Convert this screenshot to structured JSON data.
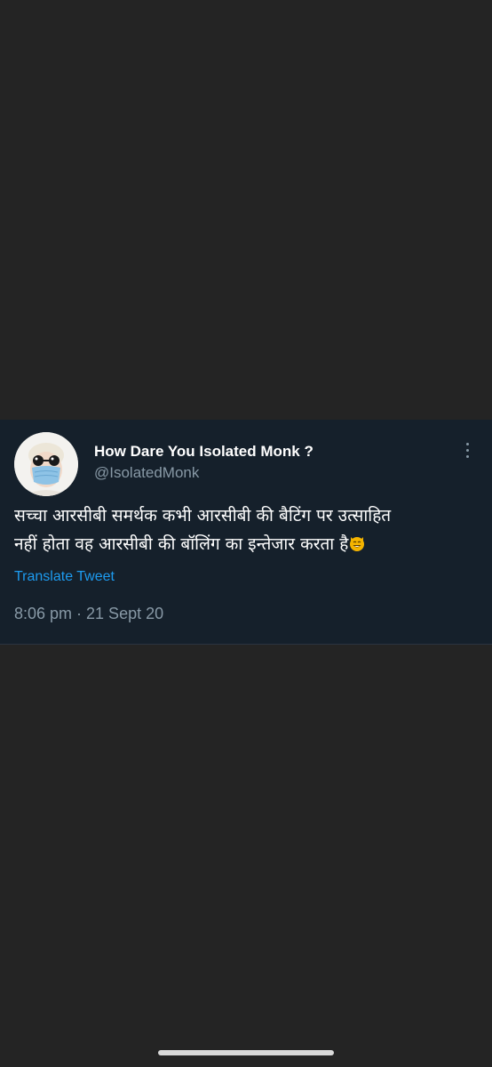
{
  "tweet": {
    "display_name": "How Dare You Isolated Monk ?",
    "handle": "@IsolatedMonk",
    "text_line1": "सच्चा आरसीबी समर्थक कभी आरसीबी की बैटिंग पर उत्साहित",
    "text_line2": "नहीं होता वह आरसीबी की बॉलिंग का इन्तेजार करता है",
    "emoji_icon": "grinning-cat-emoji",
    "translate_label": "Translate Tweet",
    "timestamp": "8:06 pm · 21 Sept 20",
    "more_icon": "more-vertical-icon"
  },
  "colors": {
    "page_background": "#242424",
    "card_background": "#15202b",
    "name_text": "#ffffff",
    "secondary_text": "#8899a6",
    "link": "#1d9bf0"
  }
}
